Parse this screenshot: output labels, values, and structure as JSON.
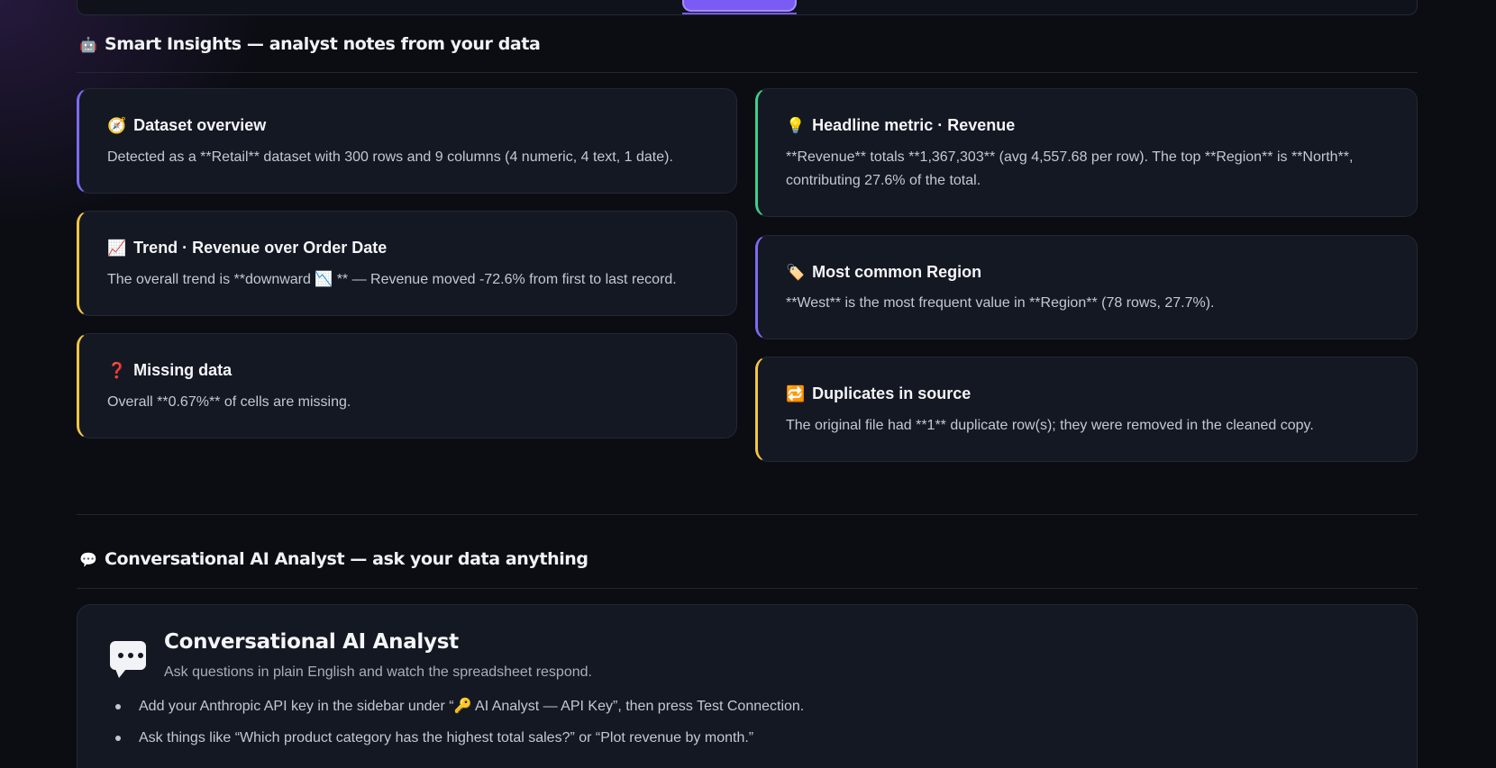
{
  "insights": {
    "heading": "Smart Insights — analyst notes from your data",
    "heading_icon": "robot-icon",
    "cards": [
      {
        "icon": "🧭",
        "icon_name": "compass-icon",
        "title": "Dataset overview",
        "text": "Detected as a **Retail** dataset with 300 rows and 9 columns (4 numeric, 4 text, 1 date).",
        "accent": "#7c6cf0"
      },
      {
        "icon": "📈",
        "icon_name": "chart-increasing-icon",
        "title": "Trend · Revenue over Order Date",
        "text": "The overall trend is **downward 📉 ** — Revenue moved -72.6% from first to last record.",
        "accent": "#f5c542"
      },
      {
        "icon": "❓",
        "icon_name": "question-mark-icon",
        "title": "Missing data",
        "text": "Overall **0.67%** of cells are missing.",
        "accent": "#f5c542"
      },
      {
        "icon": "💡",
        "icon_name": "lightbulb-icon",
        "title": "Headline metric · Revenue",
        "text": "**Revenue** totals **1,367,303** (avg 4,557.68 per row). The top **Region** is **North**, contributing 27.6% of the total.",
        "accent": "#3ecf8e"
      },
      {
        "icon": "🏷️",
        "icon_name": "tag-icon",
        "title": "Most common Region",
        "text": "**West** is the most frequent value in **Region** (78 rows, 27.7%).",
        "accent": "#7c6cf0"
      },
      {
        "icon": "🔁",
        "icon_name": "repeat-icon",
        "title": "Duplicates in source",
        "text": "The original file had **1** duplicate row(s); they were removed in the cleaned copy.",
        "accent": "#f5c542"
      }
    ]
  },
  "conversational": {
    "heading": "Conversational AI Analyst — ask your data anything",
    "heading_icon": "speech-bubble-icon",
    "panel_title": "Conversational AI Analyst",
    "panel_subtitle": "Ask questions in plain English and watch the spreadsheet respond.",
    "bullets": [
      "Add your Anthropic API key in the sidebar under “🔑 AI Analyst — API Key”, then press Test Connection.",
      "Ask things like “Which product category has the highest total sales?” or “Plot revenue by month.”"
    ]
  }
}
